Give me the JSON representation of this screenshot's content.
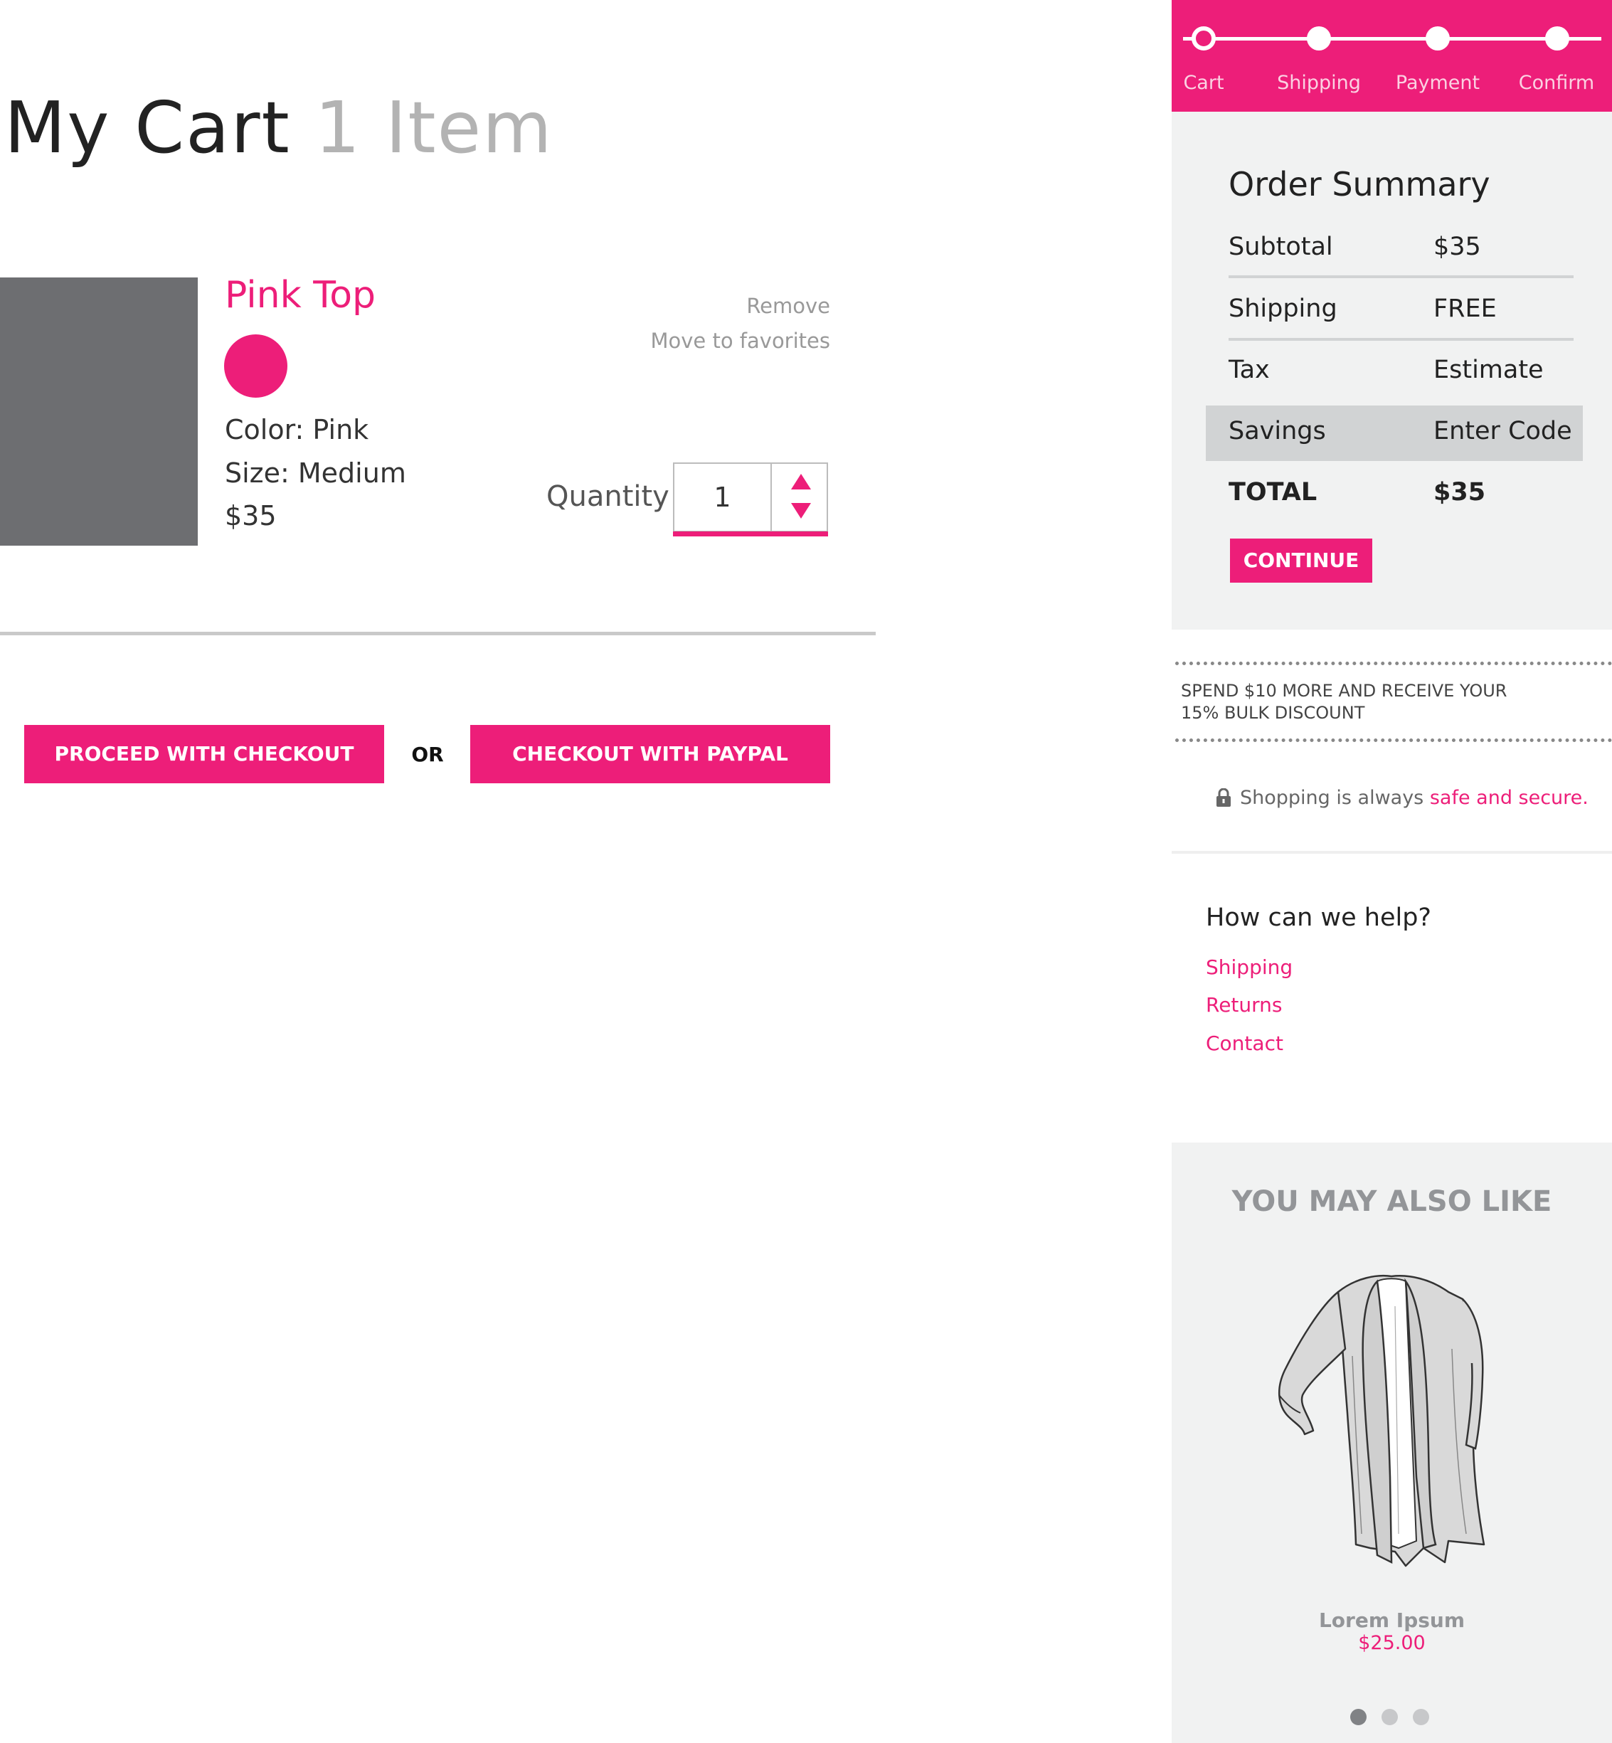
{
  "cart": {
    "title": "My Cart",
    "item_count": "1 Item"
  },
  "item": {
    "name": "Pink Top",
    "swatch_color": "#ed1e79",
    "color": "Color: Pink",
    "size": "Size: Medium",
    "price": "$35",
    "remove_label": "Remove",
    "favorites_label": "Move to favorites",
    "quantity_label": "Quantity",
    "quantity_value": "1"
  },
  "actions": {
    "checkout_label": "PROCEED WITH CHECKOUT",
    "or_label": "OR",
    "paypal_label": "CHECKOUT WITH PAYPAL"
  },
  "progress": {
    "steps": [
      "Cart",
      "Shipping",
      "Payment",
      "Confirm"
    ],
    "current_step": "Cart"
  },
  "summary": {
    "title": "Order Summary",
    "rows": [
      {
        "label": "Subtotal",
        "value": "$35"
      },
      {
        "label": "Shipping",
        "value": "FREE"
      },
      {
        "label": "Tax",
        "value": "Estimate"
      },
      {
        "label": "Savings",
        "value": "Enter Code"
      },
      {
        "label": "TOTAL",
        "value": "$35"
      }
    ],
    "continue_label": "CONTINUE"
  },
  "promo": {
    "line1": "SPEND $10 MORE AND RECEIVE YOUR",
    "line2": "15% BULK DISCOUNT"
  },
  "secure": {
    "text": "Shopping is always ",
    "link": "safe and secure."
  },
  "help": {
    "title": "How can we help?",
    "links": [
      "Shipping",
      "Returns",
      "Contact"
    ]
  },
  "recommendations": {
    "title": "YOU MAY ALSO LIKE",
    "product_name": "Lorem Ipsum",
    "product_price": "$25.00",
    "carousel_pages": 3,
    "active_page": 1
  },
  "colors": {
    "accent": "#ed1e79",
    "panel": "#f1f2f2",
    "placeholder_image": "#6d6e71"
  }
}
